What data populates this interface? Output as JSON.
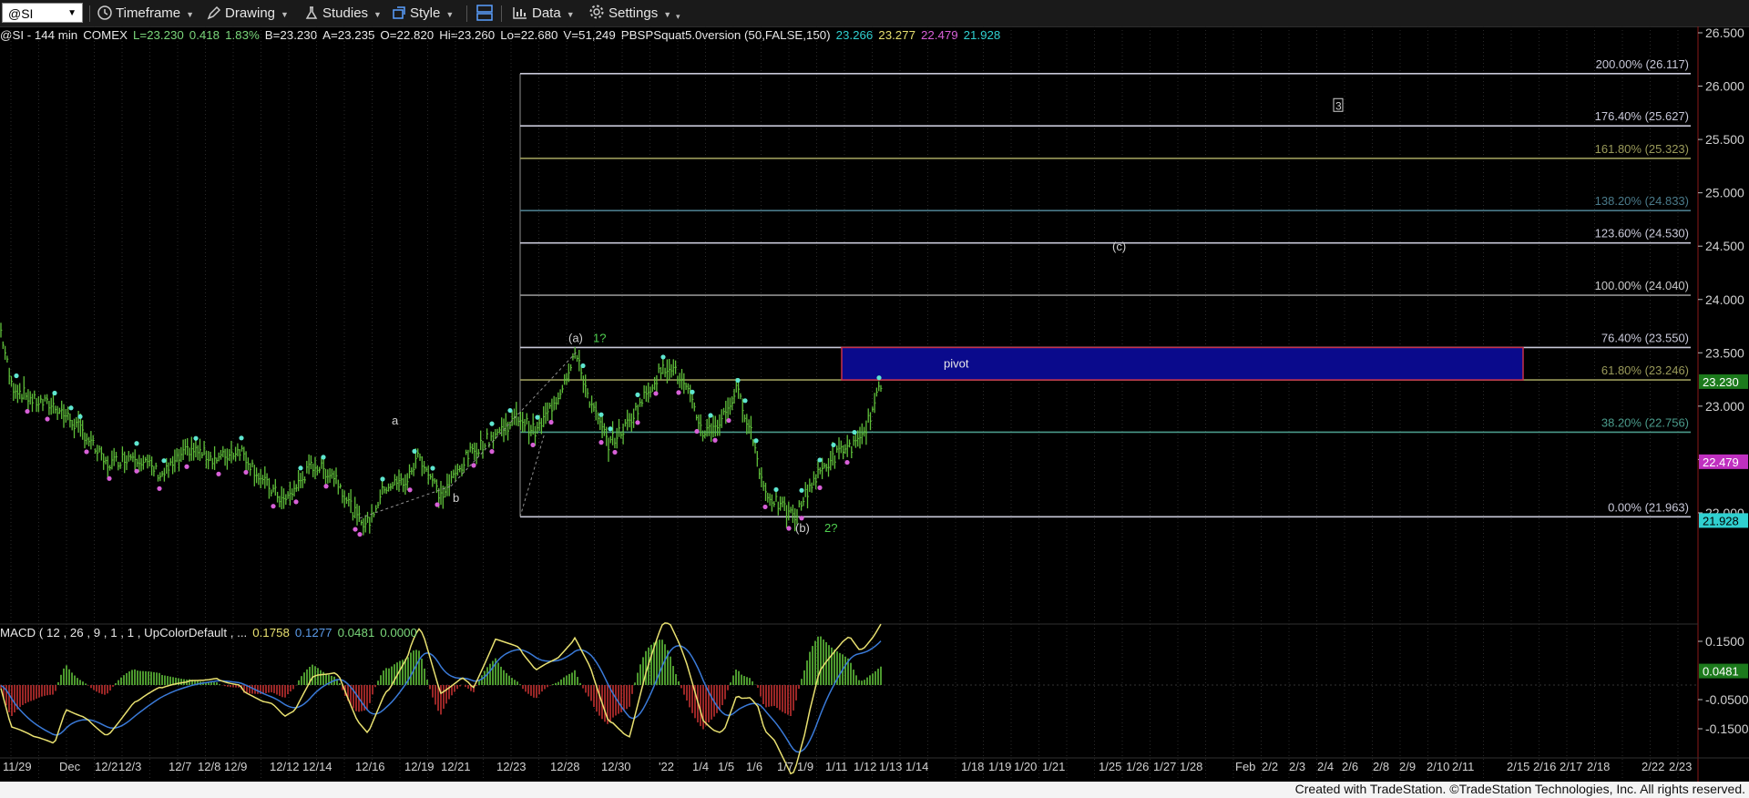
{
  "toolbar": {
    "symbol": "@SI",
    "timeframe": "Timeframe",
    "drawing": "Drawing",
    "studies": "Studies",
    "style": "Style",
    "data": "Data",
    "settings": "Settings"
  },
  "info": {
    "title": "@SI - 144 min",
    "exchange": "COMEX",
    "last": "L=23.230",
    "change": "0.418",
    "change_pct": "1.83%",
    "bid": "B=23.230",
    "ask": "A=23.235",
    "open": "O=22.820",
    "high": "Hi=23.260",
    "low": "Lo=22.680",
    "volume": "V=51,249",
    "study": "PBSPSquat5.0version (50,FALSE,150)",
    "s1": "23.266",
    "s2": "23.277",
    "s3": "22.479",
    "s4": "21.928"
  },
  "macd_label": {
    "name": "MACD ( 12 , 26 , 9 , 1 , 1 , UpColorDefault , ...",
    "v1": "0.1758",
    "v2": "0.1277",
    "v3": "0.0481",
    "v4": "0.0000"
  },
  "footer": "Created with TradeStation. ©TradeStation Technologies, Inc. All rights reserved.",
  "colors": {
    "background": "#000000",
    "bar": "#5fbf3a",
    "pivot_box": "#0a0a8c",
    "pivot_border": "#c8304a",
    "swing_high": "#5ee6d0",
    "swing_low": "#d860d8",
    "macd_line": "#e8e070",
    "signal_line": "#3a7ad8",
    "hist_up": "#5fbf3a",
    "hist_down": "#c03030"
  },
  "chart_data": [
    {
      "type": "line",
      "subtype": "ohlc-bar-chart",
      "ylim": [
        21.5,
        26.85
      ],
      "price_ticks": [
        "26.500",
        "26.000",
        "25.500",
        "25.000",
        "24.500",
        "24.000",
        "23.500",
        "23.000",
        "22.500",
        "22.000"
      ],
      "x_labels": [
        "11/29",
        "Dec",
        "12/2",
        "12/3",
        "12/7",
        "12/8",
        "12/9",
        "12/12",
        "12/14",
        "12/16",
        "12/19",
        "12/21",
        "12/23",
        "12/28",
        "12/30",
        "'22",
        "1/4",
        "1/5",
        "1/6",
        "1/7",
        "1/9",
        "1/11",
        "1/12",
        "1/13",
        "1/14",
        "1/18",
        "1/19",
        "1/20",
        "1/21",
        "1/25",
        "1/26",
        "1/27",
        "1/28",
        "Feb",
        "2/2",
        "2/3",
        "2/4",
        "2/6",
        "2/8",
        "2/9",
        "2/10",
        "2/11",
        "2/15",
        "2/16",
        "2/17",
        "2/18",
        "2/22",
        "2/23"
      ],
      "price_path": [
        [
          0,
          23.75
        ],
        [
          10,
          23.2
        ],
        [
          30,
          23.05
        ],
        [
          50,
          23.0
        ],
        [
          75,
          22.75
        ],
        [
          95,
          22.45
        ],
        [
          120,
          22.55
        ],
        [
          145,
          22.35
        ],
        [
          170,
          22.6
        ],
        [
          195,
          22.5
        ],
        [
          215,
          22.6
        ],
        [
          235,
          22.3
        ],
        [
          255,
          22.1
        ],
        [
          280,
          22.45
        ],
        [
          300,
          22.35
        ],
        [
          320,
          21.95
        ],
        [
          330,
          21.9
        ],
        [
          345,
          22.25
        ],
        [
          365,
          22.3
        ],
        [
          375,
          22.55
        ],
        [
          395,
          22.15
        ],
        [
          420,
          22.55
        ],
        [
          445,
          22.75
        ],
        [
          465,
          22.9
        ],
        [
          480,
          22.75
        ],
        [
          500,
          23.1
        ],
        [
          515,
          23.5
        ],
        [
          530,
          23.0
        ],
        [
          545,
          22.65
        ],
        [
          560,
          22.8
        ],
        [
          575,
          23.05
        ],
        [
          590,
          23.3
        ],
        [
          600,
          23.4
        ],
        [
          615,
          23.15
        ],
        [
          630,
          22.75
        ],
        [
          645,
          22.85
        ],
        [
          660,
          23.15
        ],
        [
          672,
          22.8
        ],
        [
          685,
          22.2
        ],
        [
          700,
          22.05
        ],
        [
          712,
          21.95
        ],
        [
          725,
          22.25
        ],
        [
          740,
          22.45
        ],
        [
          755,
          22.6
        ],
        [
          770,
          22.65
        ],
        [
          783,
          23.0
        ],
        [
          790,
          23.23
        ]
      ],
      "fib_levels": [
        {
          "label": "200.00% (26.117)",
          "value": 26.117,
          "color": "#c8c8d8"
        },
        {
          "label": "176.40% (25.627)",
          "value": 25.627,
          "color": "#c8c8d8"
        },
        {
          "label": "161.80% (25.323)",
          "value": 25.323,
          "color": "#9a9a5a"
        },
        {
          "label": "138.20% (24.833)",
          "value": 24.833,
          "color": "#4a7a8a"
        },
        {
          "label": "123.60% (24.530)",
          "value": 24.53,
          "color": "#c8c8d8"
        },
        {
          "label": "100.00% (24.040)",
          "value": 24.04,
          "color": "#909090"
        },
        {
          "label": "76.40% (23.550)",
          "value": 23.55,
          "color": "#c8c8d8"
        },
        {
          "label": "61.80% (23.246)",
          "value": 23.246,
          "color": "#9a9a5a"
        },
        {
          "label": "38.20% (22.756)",
          "value": 22.756,
          "color": "#4a9a8a"
        },
        {
          "label": "0.00% (21.963)",
          "value": 21.963,
          "color": "#c8c8d8"
        }
      ],
      "pivot": {
        "label": "pivot",
        "low": 23.246,
        "high": 23.55
      },
      "annotations": [
        {
          "text": "(a)",
          "value": 23.6,
          "color": "#d0d0d0"
        },
        {
          "text": "1?",
          "value": 23.6,
          "color": "#50d050"
        },
        {
          "text": "a",
          "value": 22.83,
          "color": "#d0d0d0"
        },
        {
          "text": "b",
          "value": 22.1,
          "color": "#d0d0d0"
        },
        {
          "text": "(b)",
          "value": 21.82,
          "color": "#d0d0d0"
        },
        {
          "text": "2?",
          "value": 21.82,
          "color": "#50d050"
        },
        {
          "text": "(c)",
          "value": 24.46,
          "color": "#d0d0d0"
        },
        {
          "text": "3",
          "value": 25.9,
          "color": "#d0d0d0"
        }
      ],
      "right_axis_labels": [
        {
          "text": "23.230",
          "value": 23.23,
          "bg": "#1c7a1c",
          "fg": "#ffffff"
        },
        {
          "text": "22.479",
          "value": 22.479,
          "bg": "#c030c0",
          "fg": "#ffffff"
        },
        {
          "text": "21.928",
          "value": 21.928,
          "bg": "#30d0d0",
          "fg": "#000000"
        }
      ]
    },
    {
      "type": "line",
      "subtype": "macd",
      "ylim": [
        -0.2,
        0.2
      ],
      "ticks": [
        "0.1500",
        "-0.0500",
        "-0.1500"
      ],
      "right_axis_labels": [
        {
          "text": "0.0481",
          "value": 0.0481,
          "bg": "#1c7a1c",
          "fg": "#ffffff"
        }
      ]
    }
  ]
}
